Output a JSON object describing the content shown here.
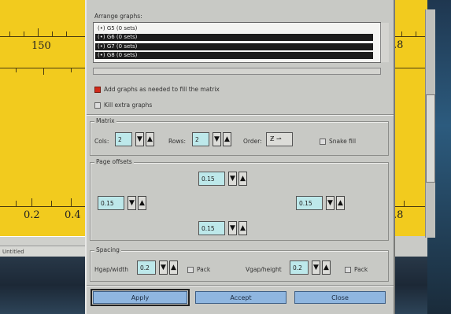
{
  "background_window": {
    "status_text": "Untitled",
    "left_axis_top": [
      "150"
    ],
    "left_axis_bottom": [
      "0.2",
      "0.4"
    ],
    "right_axis_top": ".8",
    "right_axis_bottom": ".8"
  },
  "dialog": {
    "arrange_label": "Arrange graphs:",
    "graph_list": [
      {
        "label": "(•) G5 (0 sets)",
        "selected": false
      },
      {
        "label": "(•) G6 (0 sets)",
        "selected": true
      },
      {
        "label": "(•) G7 (0 sets)",
        "selected": true
      },
      {
        "label": "(•) G8 (0 sets)",
        "selected": true
      }
    ],
    "add_graphs_label": "Add graphs as needed to fill the matrix",
    "add_graphs_checked": true,
    "kill_extra_label": "Kill extra graphs",
    "kill_extra_checked": false,
    "matrix": {
      "title": "Matrix",
      "cols_label": "Cols:",
      "cols_value": "2",
      "rows_label": "Rows:",
      "rows_value": "2",
      "order_label": "Order:",
      "snake_label": "Snake fill"
    },
    "page_offsets": {
      "title": "Page offsets",
      "top": "0.15",
      "left": "0.15",
      "right": "0.15",
      "bottom": "0.15"
    },
    "spacing": {
      "title": "Spacing",
      "hgap_label": "Hgap/width",
      "hgap_value": "0.2",
      "hpack_label": "Pack",
      "vgap_label": "Vgap/height",
      "vgap_value": "0.2",
      "vpack_label": "Pack"
    },
    "buttons": {
      "apply": "Apply",
      "accept": "Accept",
      "close": "Close"
    }
  },
  "colors": {
    "plot_bg": "#f2cb1e",
    "field_bg": "#bde8ea",
    "button_bg": "#8fb6e0",
    "dialog_bg": "#c8c9c5"
  }
}
